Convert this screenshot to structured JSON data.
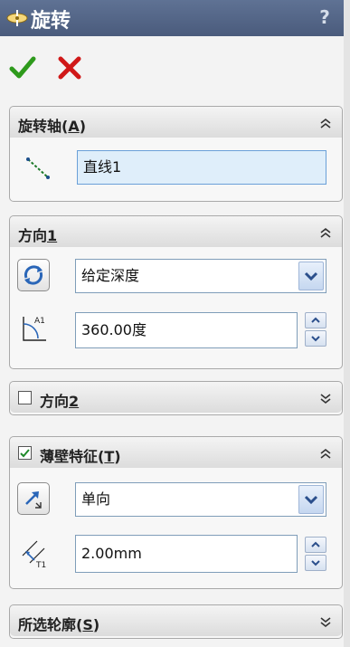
{
  "title": "旋转",
  "help_label": "?",
  "icons": {
    "title": "revolve-feature-icon",
    "ok": "green-check-icon",
    "cancel": "red-x-icon",
    "axis": "line-entity-icon",
    "reverse": "reverse-direction-icon",
    "angle": "angle-icon",
    "thin_direction": "thin-wall-direction-icon",
    "thickness": "thickness-icon"
  },
  "sections": {
    "axis": {
      "label_prefix": "旋转轴(",
      "label_key": "A",
      "label_suffix": ")",
      "value": "直线1"
    },
    "direction1": {
      "label_prefix": "方向",
      "label_key": "1",
      "end_condition": "给定深度",
      "angle": "360.00度"
    },
    "direction2": {
      "label_prefix": "方向",
      "label_key": "2",
      "checked": false
    },
    "thin_feature": {
      "label_prefix": "薄壁特征(",
      "label_key": "T",
      "label_suffix": ")",
      "checked": true,
      "type": "单向",
      "thickness": "2.00mm"
    },
    "contours": {
      "label_prefix": "所选轮廓(",
      "label_key": "S",
      "label_suffix": ")"
    }
  },
  "colors": {
    "title_bar": "#4f6183",
    "accept": "#2e9a1c",
    "cancel": "#d01818",
    "spin_arrow": "#2b4f8c"
  }
}
